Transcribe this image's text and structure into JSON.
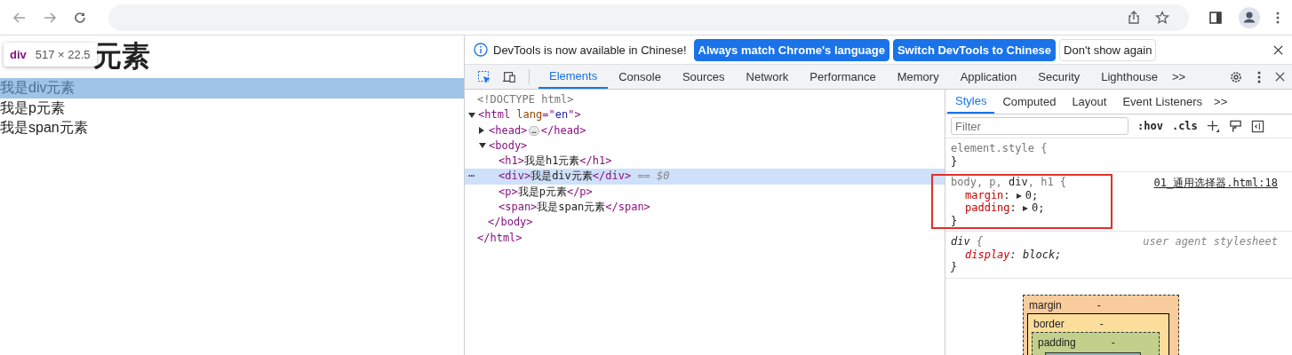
{
  "page": {
    "heading": "元素",
    "tooltip": {
      "tag": "div",
      "size": "517 × 22.5"
    },
    "lines": [
      {
        "text": "我是div元素",
        "selected": true
      },
      {
        "text": "我是p元素",
        "selected": false
      },
      {
        "text": "我是span元素",
        "selected": false
      }
    ]
  },
  "infobar": {
    "message": "DevTools is now available in Chinese!",
    "buttons": [
      {
        "label": "Always match Chrome's language",
        "kind": "primary"
      },
      {
        "label": "Switch DevTools to Chinese",
        "kind": "primary"
      },
      {
        "label": "Don't show again",
        "kind": "secondary"
      }
    ]
  },
  "tabs": [
    {
      "label": "Elements",
      "selected": true
    },
    {
      "label": "Console",
      "selected": false
    },
    {
      "label": "Sources",
      "selected": false
    },
    {
      "label": "Network",
      "selected": false
    },
    {
      "label": "Performance",
      "selected": false
    },
    {
      "label": "Memory",
      "selected": false
    },
    {
      "label": "Application",
      "selected": false
    },
    {
      "label": "Security",
      "selected": false
    },
    {
      "label": "Lighthouse",
      "selected": false
    }
  ],
  "tabs_more": ">>",
  "tree": [
    {
      "tokens": [
        {
          "kind": "doctype",
          "s": "<!DOCTYPE html>"
        }
      ],
      "selected": false
    },
    {
      "tokens": [
        {
          "kind": "tag",
          "s": "<html "
        },
        {
          "kind": "attr",
          "s": "lang"
        },
        {
          "kind": "tag",
          "s": "=\""
        },
        {
          "kind": "value",
          "s": "en"
        },
        {
          "kind": "tag",
          "s": "\">"
        }
      ],
      "selected": false,
      "expanded": true,
      "close": "</html>",
      "children": [
        {
          "tokens": [
            {
              "kind": "tag",
              "s": "<head>"
            },
            {
              "kind": "ellipsis",
              "s": "…"
            },
            {
              "kind": "tag",
              "s": "</head>"
            }
          ],
          "selected": false,
          "expanded": false
        },
        {
          "tokens": [
            {
              "kind": "tag",
              "s": "<body>"
            }
          ],
          "selected": false,
          "expanded": true,
          "close": "</body>",
          "children": [
            {
              "tokens": [
                {
                  "kind": "tag",
                  "s": "<h1>"
                },
                {
                  "kind": "text",
                  "s": "我是h1元素"
                },
                {
                  "kind": "tag",
                  "s": "</h1>"
                }
              ],
              "selected": false
            },
            {
              "tokens": [
                {
                  "kind": "tag",
                  "s": "<div>"
                },
                {
                  "kind": "text",
                  "s": "我是div元素"
                },
                {
                  "kind": "tag",
                  "s": "</div>"
                },
                {
                  "kind": "hint",
                  "s": " == $0"
                }
              ],
              "selected": true,
              "gutter": "⋯"
            },
            {
              "tokens": [
                {
                  "kind": "tag",
                  "s": "<p>"
                },
                {
                  "kind": "text",
                  "s": "我是p元素"
                },
                {
                  "kind": "tag",
                  "s": "</p>"
                }
              ],
              "selected": false
            },
            {
              "tokens": [
                {
                  "kind": "tag",
                  "s": "<span>"
                },
                {
                  "kind": "text",
                  "s": "我是span元素"
                },
                {
                  "kind": "tag",
                  "s": "</span>"
                }
              ],
              "selected": false
            }
          ]
        }
      ]
    }
  ],
  "sidebar_tabs": [
    {
      "label": "Styles",
      "selected": true
    },
    {
      "label": "Computed",
      "selected": false
    },
    {
      "label": "Layout",
      "selected": false
    },
    {
      "label": "Event Listeners",
      "selected": false
    }
  ],
  "sidebar_more": ">>",
  "filter": {
    "placeholder": "Filter"
  },
  "style_tools": [
    ":hov",
    ".cls"
  ],
  "rules": [
    {
      "selector": [
        {
          "kind": "unmatched",
          "s": "element.style"
        },
        {
          "kind": "punct",
          "s": " {"
        }
      ],
      "italic": false,
      "highlighted": false,
      "close": "}"
    },
    {
      "selector": [
        {
          "kind": "unmatched",
          "s": "body"
        },
        {
          "kind": "punct",
          "s": ", "
        },
        {
          "kind": "unmatched",
          "s": "p"
        },
        {
          "kind": "punct",
          "s": ", "
        },
        {
          "kind": "matched",
          "s": "div"
        },
        {
          "kind": "punct",
          "s": ", "
        },
        {
          "kind": "unmatched",
          "s": "h1"
        },
        {
          "kind": "punct",
          "s": " {"
        }
      ],
      "italic": false,
      "highlighted": true,
      "source": "01_通用选择器.html:18",
      "properties": [
        {
          "name": "margin",
          "colon": ":",
          "value": "0;",
          "expandable": true
        },
        {
          "name": "padding",
          "colon": ":",
          "value": "0;",
          "expandable": true
        }
      ],
      "close": "}"
    },
    {
      "selector": [
        {
          "kind": "matched",
          "s": "div"
        },
        {
          "kind": "punct",
          "s": " {"
        }
      ],
      "italic": true,
      "highlighted": false,
      "source": "user agent stylesheet",
      "properties": [
        {
          "name": "display",
          "colon": ":",
          "value": "block;",
          "expandable": false
        }
      ],
      "close": "}"
    }
  ],
  "box_model": [
    {
      "label": "margin",
      "value": "-"
    },
    {
      "label": "border",
      "value": "-"
    },
    {
      "label": "padding",
      "value": "-"
    }
  ]
}
